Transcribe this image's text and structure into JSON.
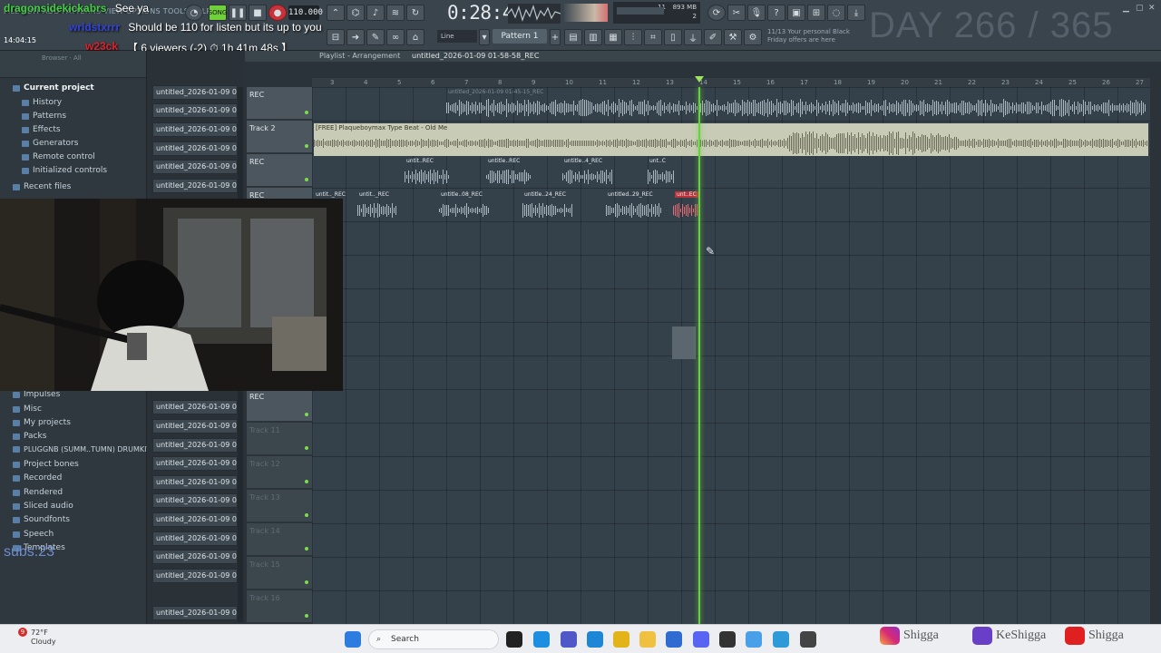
{
  "toolbar": {
    "menu_text": "FILE EDIT ADD PATTERNS VIEW OPTIONS TOOLS HELP",
    "tempo": "110.000",
    "time": "0:28:44",
    "cpu_value": "11",
    "ram_value": "893 MB",
    "voices": "2",
    "pattern": "Pattern 1",
    "snap": "Line",
    "promo_line1": "11/13 Your personal Black",
    "promo_line2": "Friday offers are here",
    "day_counter": "DAY 266 / 365"
  },
  "chat": [
    {
      "user": "dragonsidekickabrs",
      "text": "See ya",
      "color": "#40d040"
    },
    {
      "user": "wrldstxrrr",
      "text": "Should be 110 for listen but its up to you",
      "color": "#2f3fd0"
    },
    {
      "user": "w23ck",
      "text": "",
      "color": "#e0202a"
    }
  ],
  "live_status": "【 6 viewers (-2) ⏱ 1h 41m 48s 】",
  "system_time": "14:04:15",
  "browser": {
    "title": "Browser · All",
    "items_top": [
      {
        "label": "Current project",
        "bold": true
      },
      {
        "label": "History",
        "sub": true
      },
      {
        "label": "Patterns",
        "sub": true
      },
      {
        "label": "Effects",
        "sub": true
      },
      {
        "label": "Generators",
        "sub": true
      },
      {
        "label": "Remote control",
        "sub": true
      },
      {
        "label": "Initialized controls",
        "sub": true
      },
      {
        "label": "Recent files",
        "bold": false
      }
    ],
    "items_bottom": [
      "Impulses",
      "Misc",
      "My projects",
      "Packs",
      "PLUGGNB (SUMM..TUMN) DRUMKIT",
      "Project bones",
      "Recorded",
      "Rendered",
      "Sliced audio",
      "Soundfonts",
      "Speech",
      "Templates"
    ]
  },
  "subs": "subs:23",
  "clip_items": [
    "untitled_2026-01-09 01-...",
    "untitled_2026-01-09 01-...",
    "untitled_2026-01-09 01-...",
    "untitled_2026-01-09 01-...",
    "untitled_2026-01-09 01-...",
    "untitled_2026-01-09 01-...",
    "untitled_2026-01-09 01-...",
    "untitled_2026-01-09 01-...",
    "untitled_2026-01-09 01-...",
    "untitled_2026-01-09 01-...",
    "untitled_2026-01-09 01-...",
    "untitled_2026-01-09 01-...",
    "untitled_2026-01-09 01-...",
    "untitled_2026-01-09 01-...",
    "untitled_2026-01-09 01-...",
    "untitled_2026-01-09 01-...",
    "untitled_2026-01-09 01-..."
  ],
  "playlist": {
    "title": "Playlist - Arrangement",
    "file": "untitled_2026-01-09 01-58-58_REC",
    "bars": [
      "3",
      "4",
      "5",
      "6",
      "7",
      "8",
      "9",
      "10",
      "11",
      "12",
      "13",
      "14",
      "15",
      "16",
      "17",
      "18",
      "19",
      "20",
      "21",
      "22",
      "23",
      "24",
      "25",
      "26",
      "27"
    ],
    "tracks": [
      {
        "name": "REC",
        "dim": false
      },
      {
        "name": "Track 2",
        "dim": false
      },
      {
        "name": "REC",
        "dim": false
      },
      {
        "name": "REC",
        "dim": false
      },
      {
        "name": "",
        "dim": false
      },
      {
        "name": "",
        "dim": false
      },
      {
        "name": "",
        "dim": false
      },
      {
        "name": "",
        "dim": false
      },
      {
        "name": "",
        "dim": false
      },
      {
        "name": "REC",
        "dim": false
      },
      {
        "name": "Track 11",
        "dim": true
      },
      {
        "name": "Track 12",
        "dim": true
      },
      {
        "name": "Track 13",
        "dim": true
      },
      {
        "name": "Track 14",
        "dim": true
      },
      {
        "name": "Track 15",
        "dim": true
      },
      {
        "name": "Track 16",
        "dim": true
      }
    ],
    "top_clip_label": "untitled_2026-01-09 01-45-15_REC",
    "sample_clip_label": "[FREE] Plaqueboymax Type Beat - Old Me",
    "row3_labels": [
      "untit..REC",
      "untitle..REC",
      "untitle..4_REC",
      "unt..C"
    ],
    "row4_labels": [
      "untit.._REC",
      "untit.._REC",
      "untitle..08_REC",
      "untitle..24_REC",
      "untitled..29_REC",
      "unt..EC"
    ]
  },
  "taskbar": {
    "temp": "72°F",
    "weather": "Cloudy",
    "search": "Search",
    "notif_count": "9",
    "social_instagram": "Shigga",
    "social_twitch": "KeShigga",
    "social_youtube": "Shigga"
  }
}
